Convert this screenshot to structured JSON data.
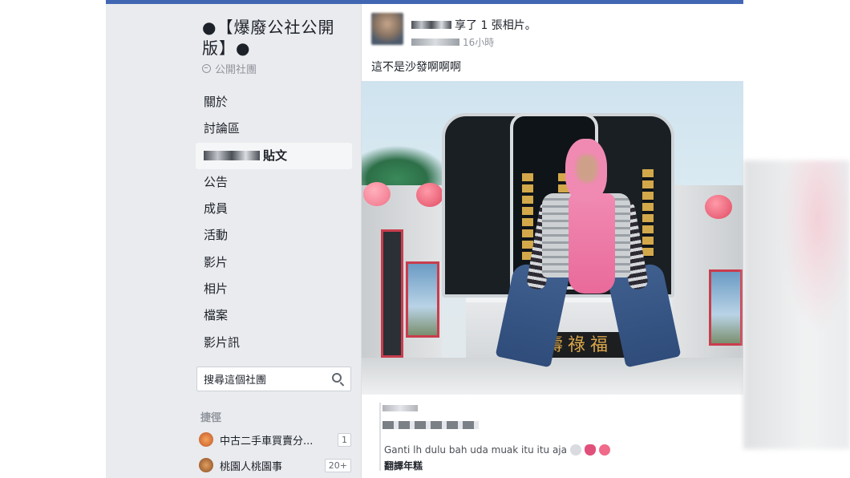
{
  "group": {
    "title": "●【爆廢公社公開版】●",
    "type": "公開社團"
  },
  "nav": {
    "items": [
      "關於",
      "討論區",
      "貼文",
      "公告",
      "成員",
      "活動",
      "影片",
      "相片",
      "檔案",
      "影片訊"
    ]
  },
  "search": {
    "placeholder": "搜尋這個社團"
  },
  "shortcuts": {
    "header": "捷徑",
    "items": [
      {
        "label": "中古二手車買賣分...",
        "count": "1"
      },
      {
        "label": "桃園人桃園事",
        "count": "20+"
      }
    ]
  },
  "post": {
    "action": "享了 1 張相片。",
    "time": "16小時",
    "text": "這不是沙發啊啊啊",
    "plaque": "壽祿福",
    "comment_text": "Ganti lh dulu bah uda muak itu itu aja",
    "see_translation": "翻譯年糕"
  },
  "colors": {
    "brand": "#4267b2",
    "page_bg": "#e9ebee"
  }
}
